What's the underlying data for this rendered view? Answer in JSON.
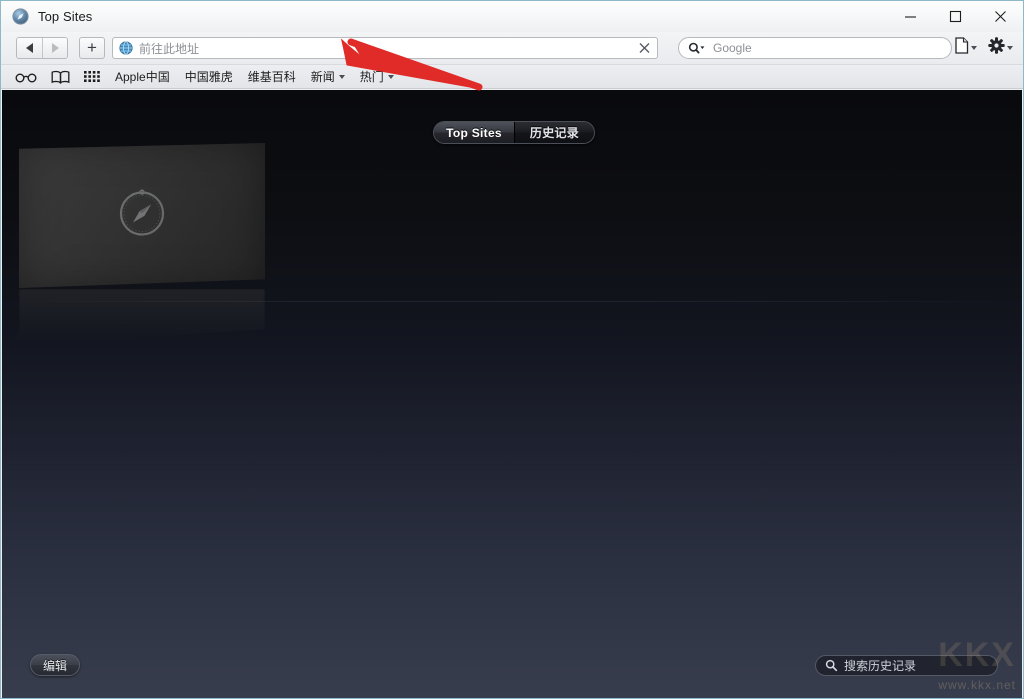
{
  "window": {
    "title": "Top Sites",
    "title_icon": "safari-compass-icon",
    "controls": {
      "minimize": "minimize-icon",
      "maximize": "maximize-icon",
      "close": "close-icon"
    }
  },
  "toolbar": {
    "back_label": "back-arrow-icon",
    "forward_label": "forward-arrow-icon",
    "new_tab_label": "+",
    "address": {
      "icon": "globe-icon",
      "value": "",
      "placeholder": "前往此地址",
      "clear_icon": "clear-x-icon"
    },
    "search": {
      "icon": "search-magnifier-icon",
      "value": "",
      "placeholder": "Google"
    },
    "right_buttons": [
      {
        "name": "page-actions-button",
        "icon": "page-document-icon",
        "has_menu": true
      },
      {
        "name": "settings-button",
        "icon": "gear-icon",
        "has_menu": true
      }
    ]
  },
  "bookmarks": {
    "icons": [
      {
        "name": "reading-glasses-icon"
      },
      {
        "name": "book-bookmarks-icon"
      },
      {
        "name": "top-sites-grid-icon"
      }
    ],
    "items": [
      {
        "label": "Apple中国",
        "has_menu": false
      },
      {
        "label": "中国雅虎",
        "has_menu": false
      },
      {
        "label": "维基百科",
        "has_menu": false
      },
      {
        "label": "新闻",
        "has_menu": true
      },
      {
        "label": "热门",
        "has_menu": true
      }
    ]
  },
  "content": {
    "toggle": {
      "options": [
        {
          "label": "Top Sites",
          "selected": true
        },
        {
          "label": "历史记录",
          "selected": false
        }
      ]
    },
    "site_slot": {
      "icon": "safari-compass-icon",
      "label": ""
    },
    "edit_button": "编辑",
    "history_search": {
      "icon": "search-magnifier-icon",
      "value": "",
      "placeholder": "搜索历史记录"
    },
    "watermark": {
      "big": "KKX",
      "small": "www.kkx.net"
    }
  },
  "annotation": {
    "arrow": {
      "color": "#e02b28",
      "points_at": "address-bar"
    }
  },
  "colors": {
    "content_top": "#090a0d",
    "content_bottom": "#383d4d",
    "chrome": "#eceef1",
    "accent_red": "#e02b28"
  }
}
